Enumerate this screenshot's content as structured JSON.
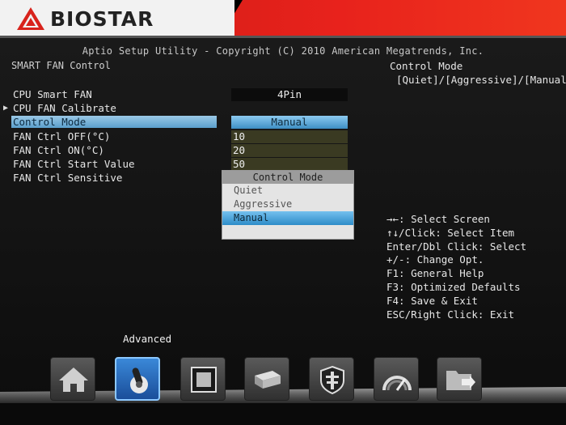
{
  "header": {
    "brand": "BIOSTAR",
    "utility_title": "Aptio Setup Utility - Copyright (C) 2010 American Megatrends, Inc."
  },
  "page": {
    "title": "SMART FAN Control"
  },
  "settings": [
    {
      "label": "CPU Smart FAN",
      "value": "4Pin"
    },
    {
      "label": "CPU FAN Calibrate",
      "value": ""
    },
    {
      "label": "Control Mode",
      "value": "Manual"
    },
    {
      "label": "FAN Ctrl OFF(°C)",
      "value": "10"
    },
    {
      "label": "FAN Ctrl ON(°C)",
      "value": "20"
    },
    {
      "label": "FAN Ctrl Start Value",
      "value": "50"
    },
    {
      "label": "FAN Ctrl Sensitive",
      "value": ""
    }
  ],
  "popup": {
    "title": "Control Mode",
    "options": [
      "Quiet",
      "Aggressive",
      "Manual"
    ],
    "selected": "Manual"
  },
  "help": {
    "title": "Control Mode",
    "description": "[Quiet]/[Aggressive]/[Manual]"
  },
  "keys": [
    "→←: Select Screen",
    "↑↓/Click: Select Item",
    "Enter/Dbl Click: Select",
    "+/-: Change Opt.",
    "F1: General Help",
    "F3: Optimized Defaults",
    "F4: Save & Exit",
    "ESC/Right Click: Exit"
  ],
  "nav": {
    "active_label": "Advanced",
    "icons": [
      "home-icon",
      "advanced-icon",
      "chipset-icon",
      "boot-icon",
      "security-icon",
      "performance-icon",
      "exit-icon"
    ]
  },
  "colors": {
    "header_red": "#e8221c",
    "highlight_blue": "#5b9fcc",
    "value_olive": "#3a3a22"
  }
}
